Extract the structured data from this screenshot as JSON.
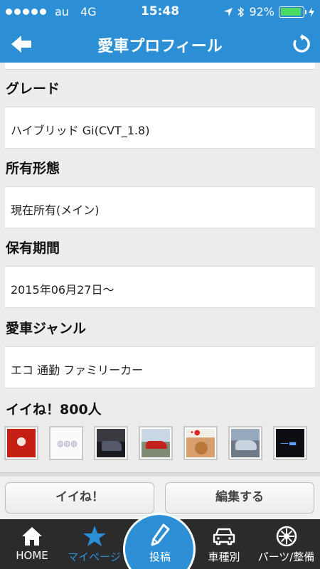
{
  "status_bar": {
    "carrier": "au",
    "network": "4G",
    "time": "15:48",
    "battery": "92%",
    "battery_level": 0.92,
    "battery_color": "#4cd964"
  },
  "nav": {
    "title": "愛車プロフィール",
    "back_icon": "back-arrow-icon",
    "refresh_icon": "refresh-icon"
  },
  "sections": {
    "grade": {
      "title": "グレード",
      "value": "ハイブリッド Gi(CVT_1.8)"
    },
    "ownership": {
      "title": "所有形態",
      "value": "現在所有(メイン)"
    },
    "period": {
      "title": "保有期間",
      "value": "2015年06月27日〜"
    },
    "genre": {
      "title": "愛車ジャンル",
      "value": "エコ 通勤 ファミリーカー"
    },
    "likes": {
      "title": "イイね！800人"
    }
  },
  "actions": {
    "like_label": "イイね！",
    "edit_label": "編集する"
  },
  "tabs": {
    "home": "HOME",
    "mypage": "マイページ",
    "post": "投稿",
    "cars": "車種別",
    "parts": "パーツ/整備"
  },
  "colors": {
    "accent": "#2c8fd6",
    "tab_bar": "#2b2b2b"
  }
}
